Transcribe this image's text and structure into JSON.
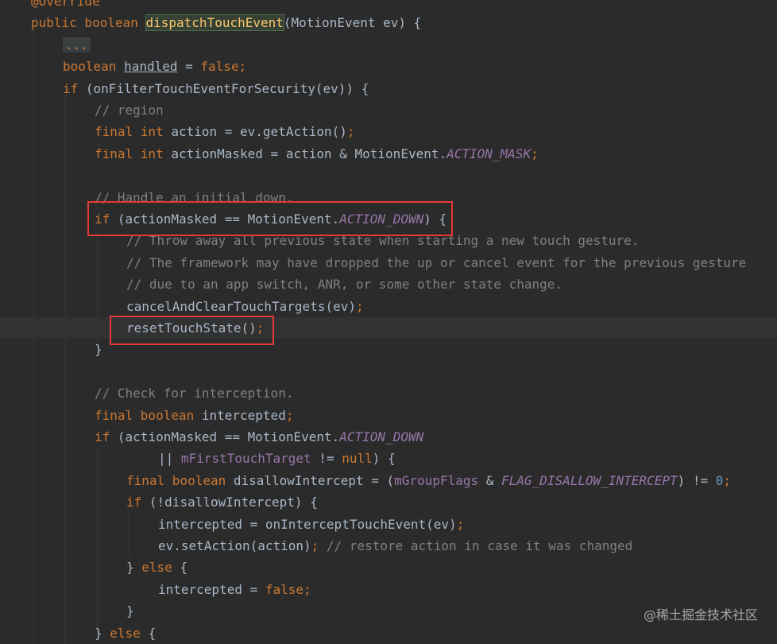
{
  "lines": [
    {
      "i": 0,
      "segs": [
        {
          "c": "kw",
          "t": "@Override"
        }
      ]
    },
    {
      "i": 0,
      "segs": [
        {
          "c": "kw",
          "t": "public boolean "
        },
        {
          "c": "fn hl-method",
          "t": "dispatchTouchEvent"
        },
        {
          "c": "pl",
          "t": "(MotionEvent ev) {"
        }
      ]
    },
    {
      "i": 1,
      "segs": [
        {
          "c": "fold",
          "t": "..."
        }
      ]
    },
    {
      "i": 1,
      "segs": [
        {
          "c": "kw",
          "t": "boolean "
        },
        {
          "c": "pl u",
          "t": "handled"
        },
        {
          "c": "pl",
          "t": " = "
        },
        {
          "c": "kw",
          "t": "false;"
        }
      ]
    },
    {
      "i": 1,
      "segs": [
        {
          "c": "kw",
          "t": "if "
        },
        {
          "c": "pl",
          "t": "(onFilterTouchEventForSecurity(ev)) {"
        }
      ]
    },
    {
      "i": 2,
      "segs": [
        {
          "c": "cm",
          "t": "// region"
        }
      ]
    },
    {
      "i": 2,
      "segs": [
        {
          "c": "kw",
          "t": "final int "
        },
        {
          "c": "pl",
          "t": "action = ev.getAction()"
        },
        {
          "c": "kw",
          "t": ";"
        }
      ]
    },
    {
      "i": 2,
      "segs": [
        {
          "c": "kw",
          "t": "final int "
        },
        {
          "c": "pl",
          "t": "actionMasked = action & MotionEvent."
        },
        {
          "c": "cn",
          "t": "ACTION_MASK"
        },
        {
          "c": "kw",
          "t": ";"
        }
      ]
    },
    {
      "i": 2,
      "segs": []
    },
    {
      "i": 2,
      "segs": [
        {
          "c": "cm",
          "t": "// Handle an initial down."
        }
      ]
    },
    {
      "i": 2,
      "segs": [
        {
          "c": "kw",
          "t": "if "
        },
        {
          "c": "pl",
          "t": "(actionMasked == MotionEvent."
        },
        {
          "c": "cn",
          "t": "ACTION_DOWN"
        },
        {
          "c": "pl",
          "t": ") {"
        }
      ]
    },
    {
      "i": 3,
      "segs": [
        {
          "c": "cm",
          "t": "// Throw away all previous state when starting a new touch gesture."
        }
      ]
    },
    {
      "i": 3,
      "segs": [
        {
          "c": "cm",
          "t": "// The framework may have dropped the up or cancel event for the previous gesture"
        }
      ]
    },
    {
      "i": 3,
      "segs": [
        {
          "c": "cm",
          "t": "// due to an app switch, ANR, or some other state change."
        }
      ]
    },
    {
      "i": 3,
      "segs": [
        {
          "c": "pl",
          "t": "cancelAndClearTouchTargets(ev)"
        },
        {
          "c": "kw",
          "t": ";"
        }
      ]
    },
    {
      "i": 3,
      "cur": true,
      "segs": [
        {
          "c": "pl",
          "t": "resetTouchState()"
        },
        {
          "c": "kw",
          "t": ";"
        }
      ]
    },
    {
      "i": 2,
      "segs": [
        {
          "c": "pl",
          "t": "}"
        }
      ]
    },
    {
      "i": 2,
      "segs": []
    },
    {
      "i": 2,
      "segs": [
        {
          "c": "cm",
          "t": "// Check for interception."
        }
      ]
    },
    {
      "i": 2,
      "segs": [
        {
          "c": "kw",
          "t": "final boolean "
        },
        {
          "c": "pl",
          "t": "intercepted"
        },
        {
          "c": "kw",
          "t": ";"
        }
      ]
    },
    {
      "i": 2,
      "segs": [
        {
          "c": "kw",
          "t": "if "
        },
        {
          "c": "pl",
          "t": "(actionMasked == MotionEvent."
        },
        {
          "c": "cn",
          "t": "ACTION_DOWN"
        }
      ]
    },
    {
      "i": 4,
      "segs": [
        {
          "c": "pl",
          "t": "|| "
        },
        {
          "c": "fld",
          "t": "mFirstTouchTarget"
        },
        {
          "c": "pl",
          "t": " != "
        },
        {
          "c": "kw",
          "t": "null"
        },
        {
          "c": "pl",
          "t": ") {"
        }
      ]
    },
    {
      "i": 3,
      "segs": [
        {
          "c": "kw",
          "t": "final boolean "
        },
        {
          "c": "pl",
          "t": "disallowIntercept = ("
        },
        {
          "c": "fld",
          "t": "mGroupFlags"
        },
        {
          "c": "pl",
          "t": " & "
        },
        {
          "c": "cn",
          "t": "FLAG_DISALLOW_INTERCEPT"
        },
        {
          "c": "pl",
          "t": ") != "
        },
        {
          "c": "num",
          "t": "0"
        },
        {
          "c": "kw",
          "t": ";"
        }
      ]
    },
    {
      "i": 3,
      "segs": [
        {
          "c": "kw",
          "t": "if "
        },
        {
          "c": "pl",
          "t": "(!disallowIntercept) {"
        }
      ]
    },
    {
      "i": 4,
      "segs": [
        {
          "c": "pl",
          "t": "intercepted = onInterceptTouchEvent(ev)"
        },
        {
          "c": "kw",
          "t": ";"
        }
      ]
    },
    {
      "i": 4,
      "segs": [
        {
          "c": "pl",
          "t": "ev.setAction(action)"
        },
        {
          "c": "kw",
          "t": "; "
        },
        {
          "c": "cm",
          "t": "// restore action in case it was changed"
        }
      ]
    },
    {
      "i": 3,
      "segs": [
        {
          "c": "pl",
          "t": "} "
        },
        {
          "c": "kw",
          "t": "else "
        },
        {
          "c": "pl",
          "t": "{"
        }
      ]
    },
    {
      "i": 4,
      "segs": [
        {
          "c": "pl",
          "t": "intercepted = "
        },
        {
          "c": "kw",
          "t": "false;"
        }
      ]
    },
    {
      "i": 3,
      "segs": [
        {
          "c": "pl",
          "t": "}"
        }
      ]
    },
    {
      "i": 2,
      "segs": [
        {
          "c": "pl",
          "t": "} "
        },
        {
          "c": "kw",
          "t": "else "
        },
        {
          "c": "pl",
          "t": "{"
        }
      ]
    }
  ],
  "watermark": "@稀土掘金技术社区"
}
